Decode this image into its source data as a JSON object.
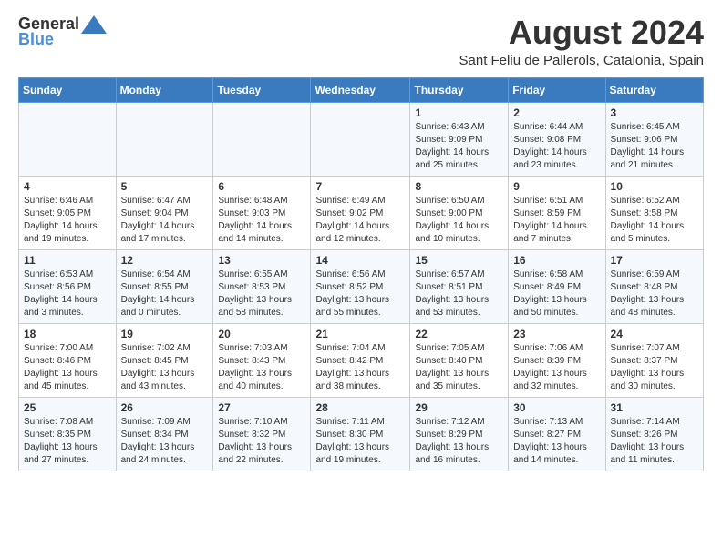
{
  "header": {
    "logo_general": "General",
    "logo_blue": "Blue",
    "month": "August 2024",
    "location": "Sant Feliu de Pallerols, Catalonia, Spain"
  },
  "weekdays": [
    "Sunday",
    "Monday",
    "Tuesday",
    "Wednesday",
    "Thursday",
    "Friday",
    "Saturday"
  ],
  "weeks": [
    [
      {
        "day": "",
        "info": ""
      },
      {
        "day": "",
        "info": ""
      },
      {
        "day": "",
        "info": ""
      },
      {
        "day": "",
        "info": ""
      },
      {
        "day": "1",
        "info": "Sunrise: 6:43 AM\nSunset: 9:09 PM\nDaylight: 14 hours and 25 minutes."
      },
      {
        "day": "2",
        "info": "Sunrise: 6:44 AM\nSunset: 9:08 PM\nDaylight: 14 hours and 23 minutes."
      },
      {
        "day": "3",
        "info": "Sunrise: 6:45 AM\nSunset: 9:06 PM\nDaylight: 14 hours and 21 minutes."
      }
    ],
    [
      {
        "day": "4",
        "info": "Sunrise: 6:46 AM\nSunset: 9:05 PM\nDaylight: 14 hours and 19 minutes."
      },
      {
        "day": "5",
        "info": "Sunrise: 6:47 AM\nSunset: 9:04 PM\nDaylight: 14 hours and 17 minutes."
      },
      {
        "day": "6",
        "info": "Sunrise: 6:48 AM\nSunset: 9:03 PM\nDaylight: 14 hours and 14 minutes."
      },
      {
        "day": "7",
        "info": "Sunrise: 6:49 AM\nSunset: 9:02 PM\nDaylight: 14 hours and 12 minutes."
      },
      {
        "day": "8",
        "info": "Sunrise: 6:50 AM\nSunset: 9:00 PM\nDaylight: 14 hours and 10 minutes."
      },
      {
        "day": "9",
        "info": "Sunrise: 6:51 AM\nSunset: 8:59 PM\nDaylight: 14 hours and 7 minutes."
      },
      {
        "day": "10",
        "info": "Sunrise: 6:52 AM\nSunset: 8:58 PM\nDaylight: 14 hours and 5 minutes."
      }
    ],
    [
      {
        "day": "11",
        "info": "Sunrise: 6:53 AM\nSunset: 8:56 PM\nDaylight: 14 hours and 3 minutes."
      },
      {
        "day": "12",
        "info": "Sunrise: 6:54 AM\nSunset: 8:55 PM\nDaylight: 14 hours and 0 minutes."
      },
      {
        "day": "13",
        "info": "Sunrise: 6:55 AM\nSunset: 8:53 PM\nDaylight: 13 hours and 58 minutes."
      },
      {
        "day": "14",
        "info": "Sunrise: 6:56 AM\nSunset: 8:52 PM\nDaylight: 13 hours and 55 minutes."
      },
      {
        "day": "15",
        "info": "Sunrise: 6:57 AM\nSunset: 8:51 PM\nDaylight: 13 hours and 53 minutes."
      },
      {
        "day": "16",
        "info": "Sunrise: 6:58 AM\nSunset: 8:49 PM\nDaylight: 13 hours and 50 minutes."
      },
      {
        "day": "17",
        "info": "Sunrise: 6:59 AM\nSunset: 8:48 PM\nDaylight: 13 hours and 48 minutes."
      }
    ],
    [
      {
        "day": "18",
        "info": "Sunrise: 7:00 AM\nSunset: 8:46 PM\nDaylight: 13 hours and 45 minutes."
      },
      {
        "day": "19",
        "info": "Sunrise: 7:02 AM\nSunset: 8:45 PM\nDaylight: 13 hours and 43 minutes."
      },
      {
        "day": "20",
        "info": "Sunrise: 7:03 AM\nSunset: 8:43 PM\nDaylight: 13 hours and 40 minutes."
      },
      {
        "day": "21",
        "info": "Sunrise: 7:04 AM\nSunset: 8:42 PM\nDaylight: 13 hours and 38 minutes."
      },
      {
        "day": "22",
        "info": "Sunrise: 7:05 AM\nSunset: 8:40 PM\nDaylight: 13 hours and 35 minutes."
      },
      {
        "day": "23",
        "info": "Sunrise: 7:06 AM\nSunset: 8:39 PM\nDaylight: 13 hours and 32 minutes."
      },
      {
        "day": "24",
        "info": "Sunrise: 7:07 AM\nSunset: 8:37 PM\nDaylight: 13 hours and 30 minutes."
      }
    ],
    [
      {
        "day": "25",
        "info": "Sunrise: 7:08 AM\nSunset: 8:35 PM\nDaylight: 13 hours and 27 minutes."
      },
      {
        "day": "26",
        "info": "Sunrise: 7:09 AM\nSunset: 8:34 PM\nDaylight: 13 hours and 24 minutes."
      },
      {
        "day": "27",
        "info": "Sunrise: 7:10 AM\nSunset: 8:32 PM\nDaylight: 13 hours and 22 minutes."
      },
      {
        "day": "28",
        "info": "Sunrise: 7:11 AM\nSunset: 8:30 PM\nDaylight: 13 hours and 19 minutes."
      },
      {
        "day": "29",
        "info": "Sunrise: 7:12 AM\nSunset: 8:29 PM\nDaylight: 13 hours and 16 minutes."
      },
      {
        "day": "30",
        "info": "Sunrise: 7:13 AM\nSunset: 8:27 PM\nDaylight: 13 hours and 14 minutes."
      },
      {
        "day": "31",
        "info": "Sunrise: 7:14 AM\nSunset: 8:26 PM\nDaylight: 13 hours and 11 minutes."
      }
    ]
  ]
}
